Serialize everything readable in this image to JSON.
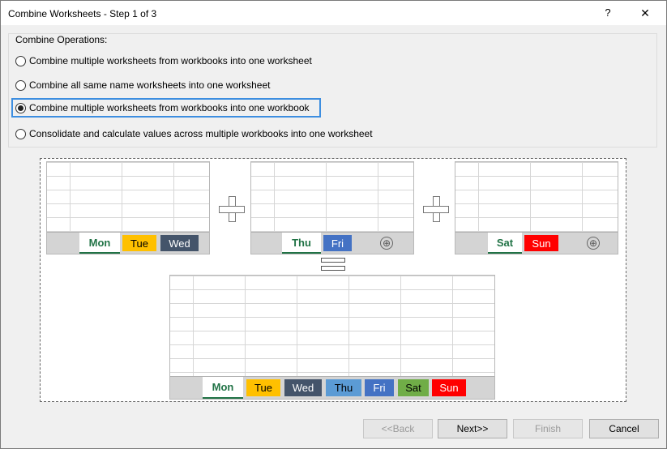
{
  "window": {
    "title": "Combine Worksheets - Step 1 of 3",
    "help": "?",
    "close": "✕"
  },
  "group": {
    "label": "Combine Operations:",
    "options": [
      "Combine multiple worksheets from workbooks into one worksheet",
      "Combine all same name worksheets into one worksheet",
      "Combine multiple worksheets from workbooks into one workbook",
      "Consolidate and calculate values across multiple workbooks into one worksheet"
    ],
    "selected_index": 2
  },
  "diagram": {
    "sheet1": {
      "tabs": [
        "Mon",
        "Tue",
        "Wed"
      ]
    },
    "sheet2": {
      "tabs": [
        "Thu",
        "Fri"
      ],
      "add": "⊕"
    },
    "sheet3": {
      "tabs": [
        "Sat",
        "Sun"
      ],
      "add": "⊕"
    },
    "result": {
      "tabs": [
        "Mon",
        "Tue",
        "Wed",
        "Thu",
        "Fri",
        "Sat",
        "Sun"
      ]
    },
    "tab_colors": {
      "Mon": "#ffffff",
      "Tue": "#ffc000",
      "Wed": "#44546a",
      "Thu": "#5b9bd5",
      "Fri": "#4472c4",
      "Sat": "#70ad47",
      "Sun": "#ff0000"
    }
  },
  "buttons": {
    "back": "<<Back",
    "next": "Next>>",
    "finish": "Finish",
    "cancel": "Cancel"
  }
}
